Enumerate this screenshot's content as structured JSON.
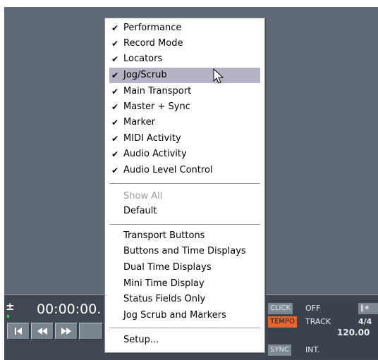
{
  "menu": {
    "toggles": [
      {
        "label": "Performance",
        "checked": true
      },
      {
        "label": "Record Mode",
        "checked": true
      },
      {
        "label": "Locators",
        "checked": true
      },
      {
        "label": "Jog/Scrub",
        "checked": true,
        "highlighted": true
      },
      {
        "label": "Main Transport",
        "checked": true
      },
      {
        "label": "Master + Sync",
        "checked": true
      },
      {
        "label": "Marker",
        "checked": true
      },
      {
        "label": "MIDI Activity",
        "checked": true
      },
      {
        "label": "Audio Activity",
        "checked": true
      },
      {
        "label": "Audio Level Control",
        "checked": true
      }
    ],
    "show_all": "Show All",
    "default": "Default",
    "presets": [
      "Transport Buttons",
      "Buttons and Time Displays",
      "Dual Time Displays",
      "Mini Time Display",
      "Status Fields Only",
      "Jog Scrub and Markers"
    ],
    "setup": "Setup..."
  },
  "transport": {
    "plus_minus": "±",
    "time": "00:00:00.",
    "buttons": [
      "go-to-start",
      "rewind",
      "fast-forward"
    ]
  },
  "status": {
    "click_tag": "CLICK",
    "click_value": "OFF",
    "tempo_tag": "TEMPO",
    "tempo_mode": "TRACK",
    "signature": "4/4",
    "tempo_value": "120.00",
    "sync_tag": "SYNC",
    "sync_value": "INT."
  },
  "colors": {
    "background": "#5e6975",
    "menu_highlight": "#b7b2c3",
    "tempo_tag": "#e8622a",
    "panel": "#3a424b"
  },
  "icons": [
    "checkmark-icon",
    "mouse-cursor-icon",
    "go-to-start-icon",
    "rewind-icon",
    "fast-forward-icon",
    "precount-icon"
  ]
}
